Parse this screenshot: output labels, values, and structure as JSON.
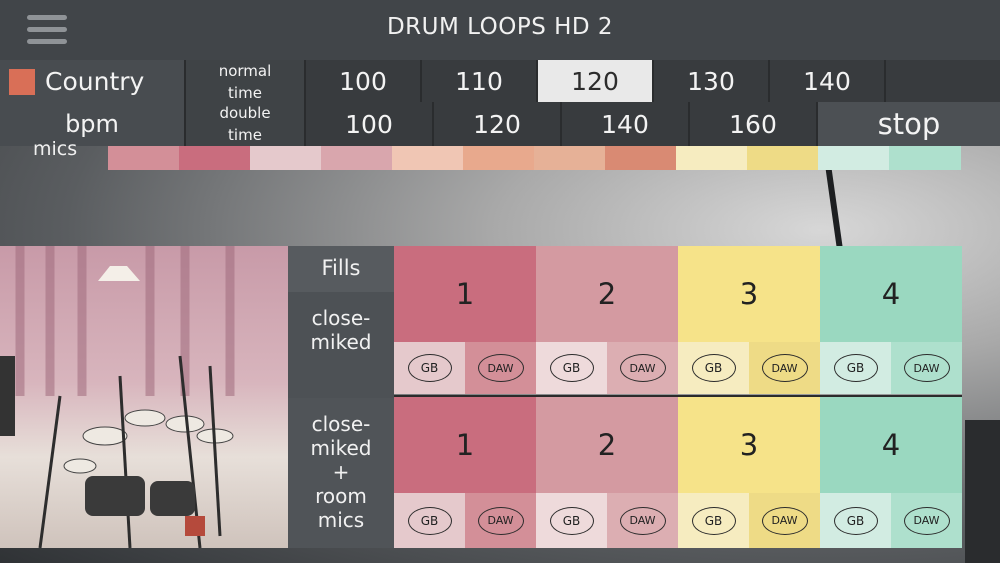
{
  "app": {
    "title": "DRUM LOOPS HD 2"
  },
  "genre": {
    "label": "Country",
    "color": "#d96f57"
  },
  "bpm_label": "bpm",
  "normal_time": {
    "label": "normal\ntime",
    "tempos": [
      "100",
      "110",
      "120",
      "130",
      "140"
    ],
    "selected": "120"
  },
  "double_time": {
    "label": "double\ntime",
    "tempos": [
      "100",
      "120",
      "140",
      "160"
    ]
  },
  "stop_label": "stop",
  "partial_section": {
    "label": "mics"
  },
  "fills": {
    "header": "Fills",
    "rows": [
      {
        "label": "close-\nmiked",
        "numbers": [
          "1",
          "2",
          "3",
          "4"
        ]
      },
      {
        "label": "close-\nmiked\n+\nroom\nmics",
        "numbers": [
          "1",
          "2",
          "3",
          "4"
        ]
      }
    ],
    "button_labels": {
      "gb": "GB",
      "daw": "DAW"
    },
    "colors": {
      "1": {
        "num": "#c96d7e",
        "gb": "#e5c9cc",
        "daw": "#d38f98"
      },
      "2": {
        "num": "#d49aa1",
        "gb": "#eedadb",
        "daw": "#dcaeb2"
      },
      "3": {
        "num": "#f6e389",
        "gb": "#f6ecc0",
        "daw": "#eedb86"
      },
      "4": {
        "num": "#9ad8c0",
        "gb": "#d2ece2",
        "daw": "#aee0cd"
      }
    }
  }
}
